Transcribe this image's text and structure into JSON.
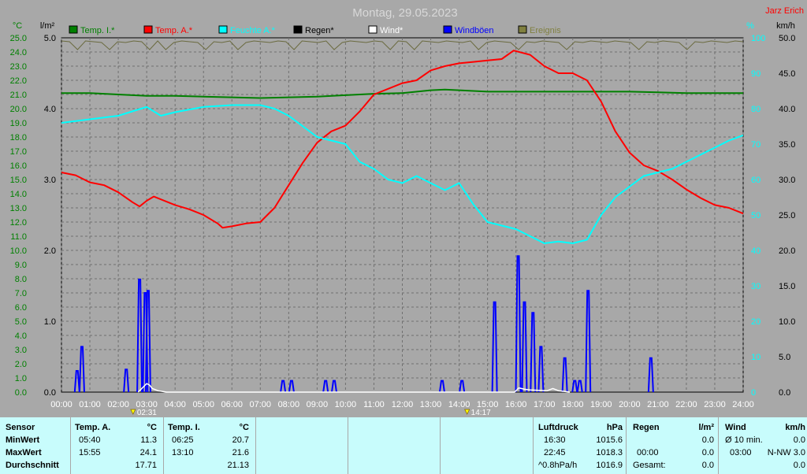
{
  "title": "Montag, 29.05.2023",
  "station": "Jarz Erich",
  "units": {
    "temp": "°C",
    "rain": "l/m²",
    "humidity": "%",
    "wind": "km/h"
  },
  "legend": [
    {
      "label": "Temp. I.*",
      "color": "#008000"
    },
    {
      "label": "Temp. A.*",
      "color": "#ff0000"
    },
    {
      "label": "Feuchte A.*",
      "color": "#00ffff"
    },
    {
      "label": "Regen*",
      "color": "#000000"
    },
    {
      "label": "Wind*",
      "color": "#ffffff"
    },
    {
      "label": "Windböen",
      "color": "#0000ff"
    },
    {
      "label": "Ereignis",
      "color": "#808040"
    }
  ],
  "markers": [
    {
      "time": "02:31",
      "hour": 2.52,
      "icon": "sunrise-icon"
    },
    {
      "time": "14:17",
      "hour": 14.28,
      "icon": "sunset-icon"
    }
  ],
  "chart_data": {
    "type": "line",
    "x_unit": "hour",
    "xlim": [
      0,
      24
    ],
    "x_ticks": [
      "00:00",
      "01:00",
      "02:00",
      "03:00",
      "04:00",
      "05:00",
      "06:00",
      "07:00",
      "08:00",
      "09:00",
      "10:00",
      "11:00",
      "12:00",
      "13:00",
      "14:00",
      "15:00",
      "16:00",
      "17:00",
      "18:00",
      "19:00",
      "20:00",
      "21:00",
      "22:00",
      "23:00",
      "24:00"
    ],
    "axes": {
      "temp": {
        "ylim": [
          0,
          25
        ],
        "ticks": [
          "0.0",
          "1.0",
          "2.0",
          "3.0",
          "4.0",
          "5.0",
          "6.0",
          "7.0",
          "8.0",
          "9.0",
          "10.0",
          "11.0",
          "12.0",
          "13.0",
          "14.0",
          "15.0",
          "16.0",
          "17.0",
          "18.0",
          "19.0",
          "20.0",
          "21.0",
          "22.0",
          "23.0",
          "24.0",
          "25.0"
        ]
      },
      "rain": {
        "ylim": [
          0,
          5
        ],
        "ticks": [
          "0.0",
          "1.0",
          "2.0",
          "3.0",
          "4.0",
          "5.0"
        ]
      },
      "humidity": {
        "ylim": [
          0,
          100
        ],
        "ticks": [
          "0",
          "10",
          "20",
          "30",
          "40",
          "50",
          "60",
          "70",
          "80",
          "90",
          "100"
        ]
      },
      "wind": {
        "ylim": [
          0,
          50
        ],
        "ticks": [
          "0.0",
          "5.0",
          "10.0",
          "15.0",
          "20.0",
          "25.0",
          "30.0",
          "35.0",
          "40.0",
          "45.0",
          "50.0"
        ]
      }
    },
    "series": [
      {
        "name": "Temp. I.*",
        "axis": "temp",
        "color": "#008000",
        "x": [
          0,
          1,
          2,
          3,
          4,
          5,
          6,
          7,
          8,
          9,
          10,
          11,
          12,
          13,
          13.5,
          14,
          15,
          16,
          17,
          18,
          19,
          20,
          21,
          22,
          23,
          24
        ],
        "y": [
          21.1,
          21.1,
          21.0,
          20.9,
          20.9,
          20.85,
          20.8,
          20.75,
          20.8,
          20.85,
          20.95,
          21.05,
          21.1,
          21.3,
          21.35,
          21.3,
          21.2,
          21.2,
          21.2,
          21.2,
          21.2,
          21.2,
          21.15,
          21.1,
          21.1,
          21.1
        ]
      },
      {
        "name": "Temp. A.*",
        "axis": "temp",
        "color": "#ff0000",
        "x": [
          0,
          0.5,
          1,
          1.5,
          2,
          2.5,
          2.75,
          3,
          3.25,
          3.5,
          4,
          4.5,
          5,
          5.5,
          5.67,
          6,
          6.5,
          7,
          7.5,
          8,
          8.5,
          9,
          9.5,
          10,
          10.5,
          11,
          11.5,
          12,
          12.5,
          13,
          13.5,
          14,
          14.5,
          15,
          15.5,
          15.92,
          16.5,
          17,
          17.5,
          18,
          18.5,
          19,
          19.5,
          20,
          20.5,
          21,
          21.5,
          22,
          22.5,
          23,
          23.5,
          24
        ],
        "y": [
          15.5,
          15.3,
          14.8,
          14.6,
          14.1,
          13.4,
          13.1,
          13.5,
          13.8,
          13.6,
          13.2,
          12.9,
          12.5,
          11.9,
          11.6,
          11.7,
          11.9,
          12.0,
          13.0,
          14.6,
          16.2,
          17.6,
          18.4,
          18.8,
          19.8,
          21.0,
          21.4,
          21.8,
          22.0,
          22.7,
          23.0,
          23.2,
          23.3,
          23.4,
          23.5,
          24.1,
          23.8,
          23.0,
          22.5,
          22.5,
          22.0,
          20.5,
          18.4,
          16.9,
          16.0,
          15.6,
          15.0,
          14.3,
          13.7,
          13.2,
          13.0,
          12.6
        ]
      },
      {
        "name": "Feuchte A.*",
        "axis": "humidity",
        "color": "#00ffff",
        "x": [
          0,
          1,
          2,
          2.8,
          3,
          3.5,
          4,
          5,
          6,
          7,
          7.5,
          8,
          9,
          10,
          10.5,
          11,
          11.5,
          12,
          12.5,
          13,
          13.5,
          14,
          14.5,
          15,
          15.5,
          16,
          16.5,
          17,
          17.5,
          18,
          18.5,
          19,
          19.5,
          20,
          20.5,
          21,
          21.5,
          22,
          22.5,
          23,
          23.5,
          24
        ],
        "y": [
          76,
          77,
          78,
          80,
          80.5,
          78,
          79,
          80.5,
          81,
          81,
          80,
          78,
          72,
          70,
          65,
          63,
          60,
          59,
          61,
          59,
          57,
          59,
          53,
          48,
          47,
          46,
          44,
          42,
          42.5,
          42,
          43,
          50,
          55,
          58,
          61,
          62,
          63,
          65,
          67,
          69,
          71,
          72.5
        ]
      },
      {
        "name": "Windböen",
        "axis": "wind",
        "color": "#0000ff",
        "mode": "bars",
        "x": [
          0.55,
          0.72,
          2.28,
          2.75,
          2.95,
          3.05,
          7.8,
          8.1,
          9.3,
          9.6,
          13.4,
          14.1,
          15.25,
          16.08,
          16.3,
          16.6,
          16.88,
          17.72,
          18.07,
          18.25,
          18.54,
          20.75
        ],
        "y": [
          3.0,
          6.4,
          3.2,
          15.9,
          14.0,
          14.3,
          1.6,
          1.6,
          1.6,
          1.6,
          1.6,
          1.6,
          12.7,
          19.2,
          12.7,
          11.2,
          6.4,
          4.8,
          1.6,
          1.6,
          14.3,
          4.8
        ]
      },
      {
        "name": "Wind*",
        "axis": "wind",
        "color": "#ffffff",
        "x": [
          2.7,
          2.9,
          3.0,
          3.1,
          3.2,
          3.4,
          3.7,
          15.95,
          16.1,
          16.3,
          16.5,
          17.1,
          17.3,
          17.5,
          17.9
        ],
        "y": [
          0,
          0.8,
          1.2,
          1.0,
          0.5,
          0.2,
          0,
          0,
          0.6,
          0.4,
          0.3,
          0.2,
          0.5,
          0.2,
          0
        ]
      }
    ],
    "events": [
      1,
      1,
      0,
      1,
      1,
      1,
      0,
      1,
      1,
      1,
      1,
      0,
      1,
      0,
      1,
      1,
      1,
      1,
      0,
      1,
      1,
      1,
      0,
      1,
      1,
      1,
      1,
      1,
      1,
      0,
      1,
      1,
      1,
      1,
      0,
      1,
      1,
      1,
      1,
      1,
      1,
      0,
      1,
      1,
      0,
      1,
      1,
      1,
      1,
      1,
      1,
      1,
      0,
      1,
      1,
      1,
      1,
      0,
      1,
      1,
      1,
      1,
      1,
      0,
      1,
      1,
      1,
      1,
      1,
      1,
      1,
      1,
      0,
      1,
      1,
      1,
      1,
      1,
      0,
      1,
      1,
      1,
      1,
      1,
      1,
      1
    ]
  },
  "stats": {
    "row_labels": [
      "Sensor",
      "MinWert",
      "MaxWert",
      "Durchschnitt"
    ],
    "temp_a": {
      "header": "Temp. A.",
      "unit": "°C",
      "min_time": "05:40",
      "min": "11.3",
      "max_time": "15:55",
      "max": "24.1",
      "avg": "17.71"
    },
    "temp_i": {
      "header": "Temp. I.",
      "unit": "°C",
      "min_time": "06:25",
      "min": "20.7",
      "max_time": "13:10",
      "max": "21.6",
      "avg": "21.13"
    },
    "pressure": {
      "header": "Luftdruck",
      "unit": "hPa",
      "min_time": "16:30",
      "min": "1015.6",
      "max_time": "22:45",
      "max": "1018.3",
      "trend": "^0.8hPa/h",
      "avg": "1016.9"
    },
    "rain": {
      "header": "Regen",
      "unit": "l/m²",
      "val1": "0.0",
      "r2_time": "00:00",
      "val2": "0.0",
      "total_label": "Gesamt:",
      "total": "0.0"
    },
    "wind": {
      "header": "Wind",
      "unit": "km/h",
      "r1_label": "Ø 10 min.",
      "r1_val": "0.0",
      "r2_time": "03:00",
      "r2_val": "N-NW 3.0",
      "r3_val": "0.0"
    }
  }
}
